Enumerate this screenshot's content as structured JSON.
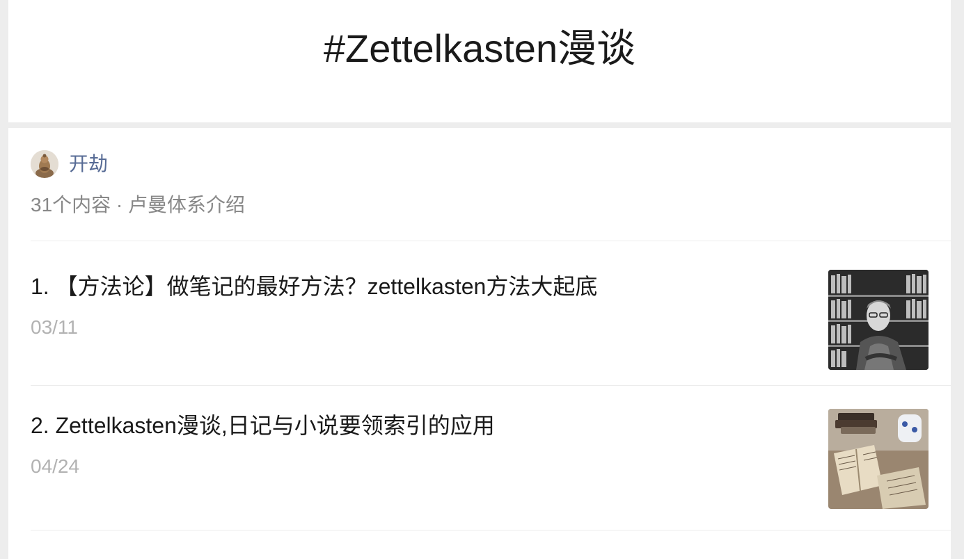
{
  "header": {
    "title": "#Zettelkasten漫谈"
  },
  "author": {
    "name": "开劫",
    "avatar_icon": "buddha-statue-avatar"
  },
  "collection": {
    "meta": "31个内容 · 卢曼体系介绍"
  },
  "articles": [
    {
      "title": "1. 【方法论】做笔记的最好方法？zettelkasten方法大起底",
      "date": "03/11",
      "thumbnail": "portrait-bookshelf-photo"
    },
    {
      "title": "2. Zettelkasten漫谈,日记与小说要领索引的应用",
      "date": "04/24",
      "thumbnail": "notebooks-on-table-photo"
    }
  ],
  "colors": {
    "background": "#ededed",
    "card": "#ffffff",
    "author_link": "#576b95",
    "meta_text": "#888888",
    "date_text": "#b2b2b2",
    "title_text": "#1a1a1a"
  }
}
